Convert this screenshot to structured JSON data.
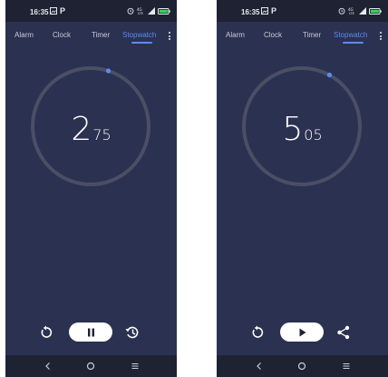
{
  "screens": [
    {
      "status": {
        "time": "16:35",
        "app_glyph": "P"
      },
      "tabs": [
        "Alarm",
        "Clock",
        "Timer",
        "Stopwatch"
      ],
      "active_tab": "Stopwatch",
      "stopwatch": {
        "seconds": "2",
        "centiseconds": "75",
        "running": true
      },
      "controls": {
        "left": "reset-icon",
        "center": "pause-icon",
        "right": "lap-icon"
      }
    },
    {
      "status": {
        "time": "16:35",
        "app_glyph": "P"
      },
      "tabs": [
        "Alarm",
        "Clock",
        "Timer",
        "Stopwatch"
      ],
      "active_tab": "Stopwatch",
      "stopwatch": {
        "seconds": "5",
        "centiseconds": "05",
        "running": false
      },
      "controls": {
        "left": "reset-icon",
        "center": "play-icon",
        "right": "share-icon"
      }
    }
  ],
  "colors": {
    "background": "#2b3150",
    "bars": "#1f2233",
    "accent": "#5b8bf2",
    "dial_track": "#4a4f66"
  }
}
